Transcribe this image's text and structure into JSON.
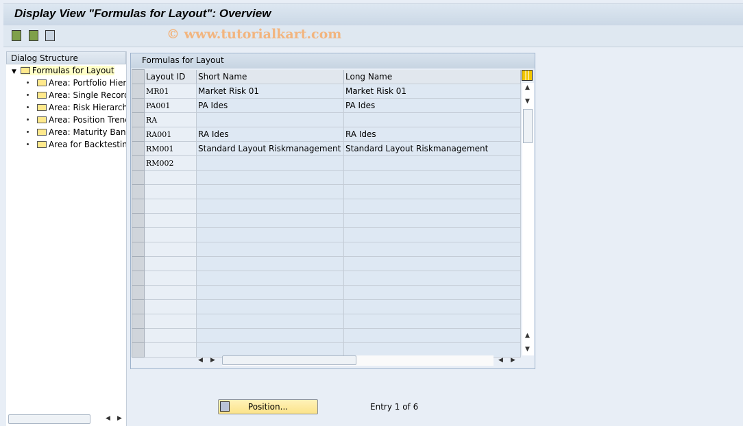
{
  "title": "Display View \"Formulas for Layout\": Overview",
  "watermark": "© www.tutorialkart.com",
  "toolbar": {
    "icons": [
      "select-all-icon",
      "select-block-icon",
      "deselect-all-icon"
    ]
  },
  "dialog": {
    "header": "Dialog Structure",
    "root": "Formulas for Layout",
    "children": [
      "Area: Portfolio Hierar",
      "Area: Single Records",
      "Area: Risk Hierarchy",
      "Area: Position Trend",
      "Area: Maturity Band",
      "Area for Backtesting"
    ]
  },
  "table": {
    "caption": "Formulas for Layout",
    "columns": [
      "Layout ID",
      "Short Name",
      "Long Name"
    ],
    "rows": [
      [
        "MR01",
        "Market Risk 01",
        "Market Risk 01"
      ],
      [
        "PA001",
        "PA Ides",
        "PA Ides"
      ],
      [
        "RA",
        "",
        ""
      ],
      [
        "RA001",
        "RA Ides",
        "RA Ides"
      ],
      [
        "RM001",
        "Standard Layout Riskmanagement",
        "Standard Layout Riskmanagement"
      ],
      [
        "RM002",
        "",
        ""
      ]
    ]
  },
  "position_button": "Position...",
  "status": "Entry 1 of 6"
}
